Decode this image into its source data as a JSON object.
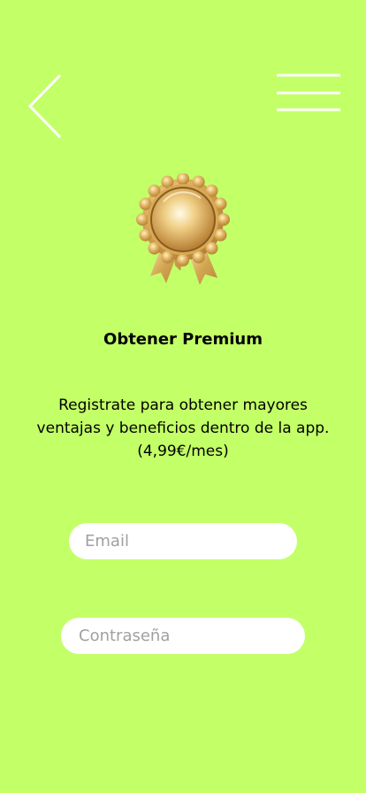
{
  "nav": {
    "back_icon": "chevron-left-icon",
    "menu_icon": "hamburger-menu-icon"
  },
  "hero": {
    "icon": "gold-medal-icon",
    "title": "Obtener Premium",
    "description": "Registrate para obtener mayores ventajas y beneficios dentro de la app.(4,99€/mes)"
  },
  "form": {
    "email_placeholder": "Email",
    "password_placeholder": "Contraseña"
  },
  "colors": {
    "background": "#c3ff67",
    "icon_stroke": "#ffffff",
    "medal_gold": "#d4a84a"
  }
}
